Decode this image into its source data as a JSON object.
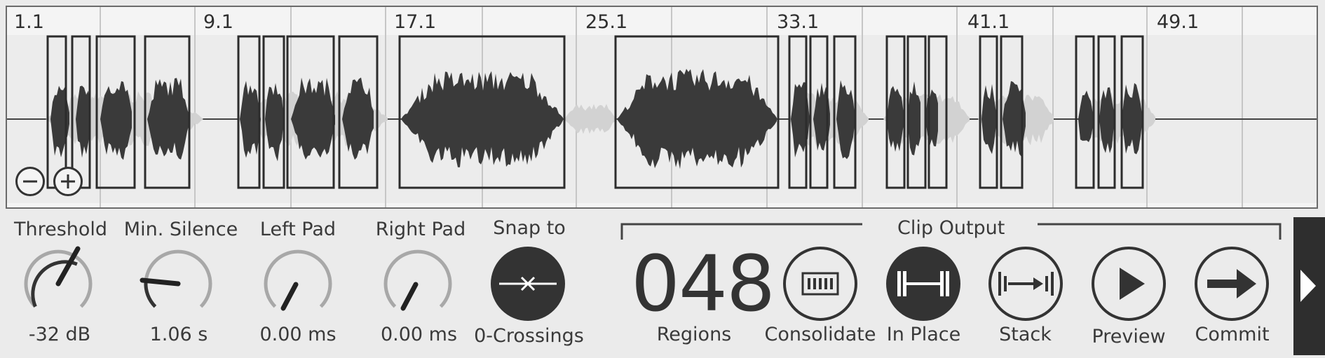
{
  "ruler": {
    "bar_labels": [
      "1.1",
      "9.1",
      "17.1",
      "25.1",
      "33.1",
      "41.1",
      "49.1"
    ]
  },
  "zoom": {
    "zoom_out_icon": "minus-circle-icon",
    "zoom_in_icon": "plus-circle-icon"
  },
  "controls": {
    "threshold": {
      "label": "Threshold",
      "value": "-32 dB"
    },
    "min_silence": {
      "label": "Min. Silence",
      "value": "1.06 s"
    },
    "left_pad": {
      "label": "Left Pad",
      "value": "0.00 ms"
    },
    "right_pad": {
      "label": "Right Pad",
      "value": "0.00 ms"
    },
    "snap": {
      "label": "Snap to",
      "value": "0-Crossings",
      "icon": "zero-crossing-icon"
    }
  },
  "clip_output": {
    "title": "Clip Output",
    "regions_count": "048",
    "regions_label": "Regions",
    "buttons": [
      {
        "label": "Consolidate",
        "icon": "consolidate-icon",
        "active": false
      },
      {
        "label": "In Place",
        "icon": "in-place-icon",
        "active": true
      },
      {
        "label": "Stack",
        "icon": "stack-icon",
        "active": false
      },
      {
        "label": "Preview",
        "icon": "play-icon",
        "active": false
      },
      {
        "label": "Commit",
        "icon": "arrow-right-icon",
        "active": false
      }
    ]
  },
  "side_tab": {
    "icon": "chevron-right-icon"
  },
  "colors": {
    "background": "#ebebeb",
    "waveform": "#3a3a3a",
    "waveform_dim": "#cfcfcf",
    "accent_dark": "#2e2e2e"
  }
}
